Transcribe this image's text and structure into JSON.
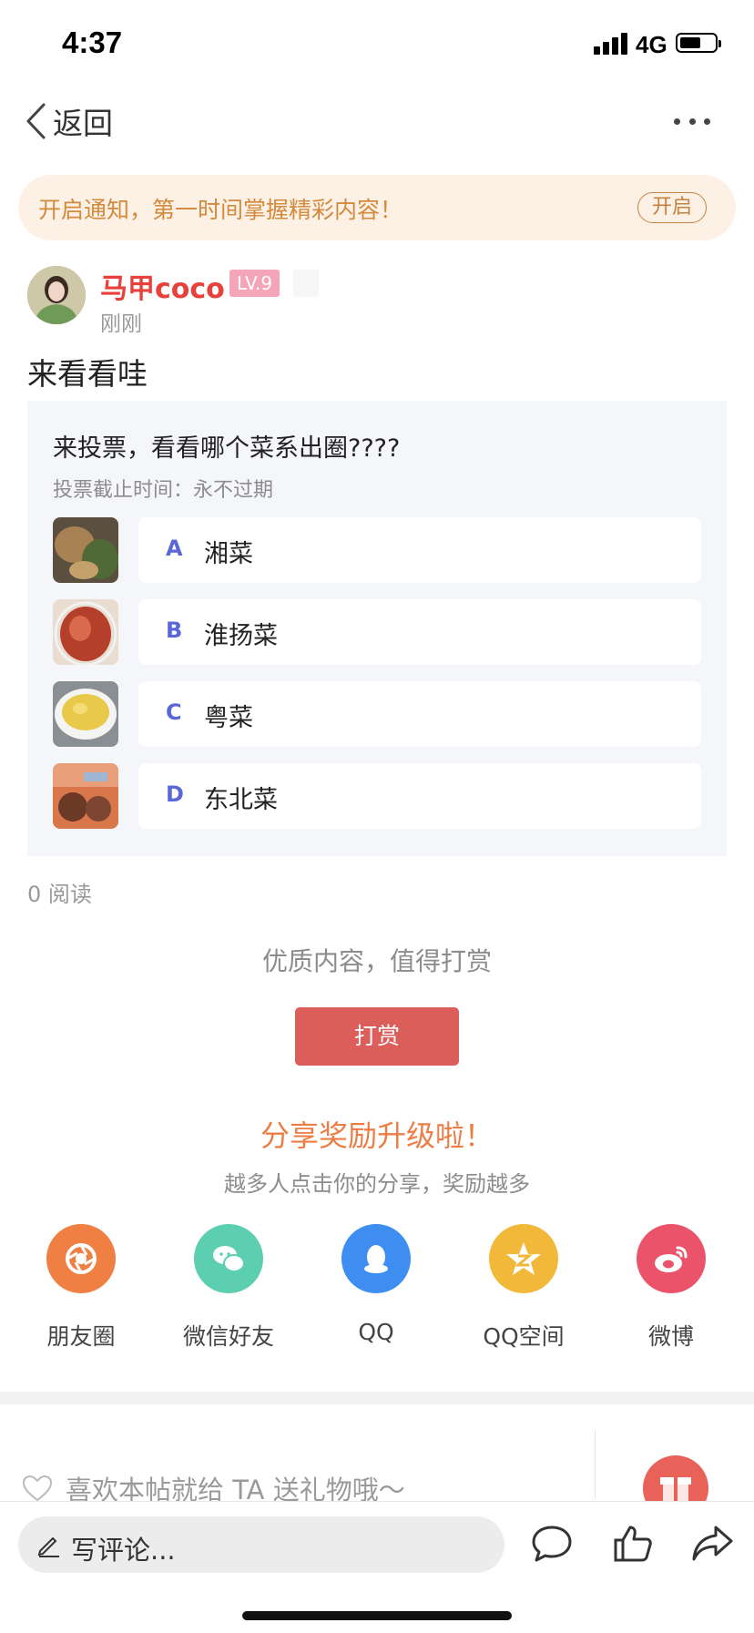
{
  "status_bar": {
    "time": "4:37",
    "network": "4G"
  },
  "nav": {
    "back_label": "返回"
  },
  "notice": {
    "text": "开启通知，第一时间掌握精彩内容！",
    "button": "开启"
  },
  "author": {
    "name": "马甲coco",
    "level": "LV.9",
    "time": "刚刚"
  },
  "post": {
    "text": "来看看哇"
  },
  "vote": {
    "title": "来投票，看看哪个菜系出圈????",
    "deadline": "投票截止时间：永不过期",
    "options": [
      {
        "letter": "A",
        "label": "湘菜"
      },
      {
        "letter": "B",
        "label": "淮扬菜"
      },
      {
        "letter": "C",
        "label": "粤菜"
      },
      {
        "letter": "D",
        "label": "东北菜"
      }
    ]
  },
  "stats": {
    "reads": "0 阅读"
  },
  "reward": {
    "subtitle": "优质内容，值得打赏",
    "button": "打赏"
  },
  "share": {
    "title": "分享奖励升级啦！",
    "subtitle": "越多人点击你的分享，奖励越多",
    "items": [
      {
        "label": "朋友圈",
        "icon": "moments-icon",
        "color": "#f07f43"
      },
      {
        "label": "微信好友",
        "icon": "wechat-icon",
        "color": "#5ccfb0"
      },
      {
        "label": "QQ",
        "icon": "qq-icon",
        "color": "#3d8ef0"
      },
      {
        "label": "QQ空间",
        "icon": "qzone-icon",
        "color": "#f2b83a"
      },
      {
        "label": "微博",
        "icon": "weibo-icon",
        "color": "#ea5369"
      }
    ]
  },
  "gift": {
    "hint": "喜欢本帖就给 TA 送礼物哦～"
  },
  "bottom_bar": {
    "comment_placeholder": "写评论..."
  }
}
